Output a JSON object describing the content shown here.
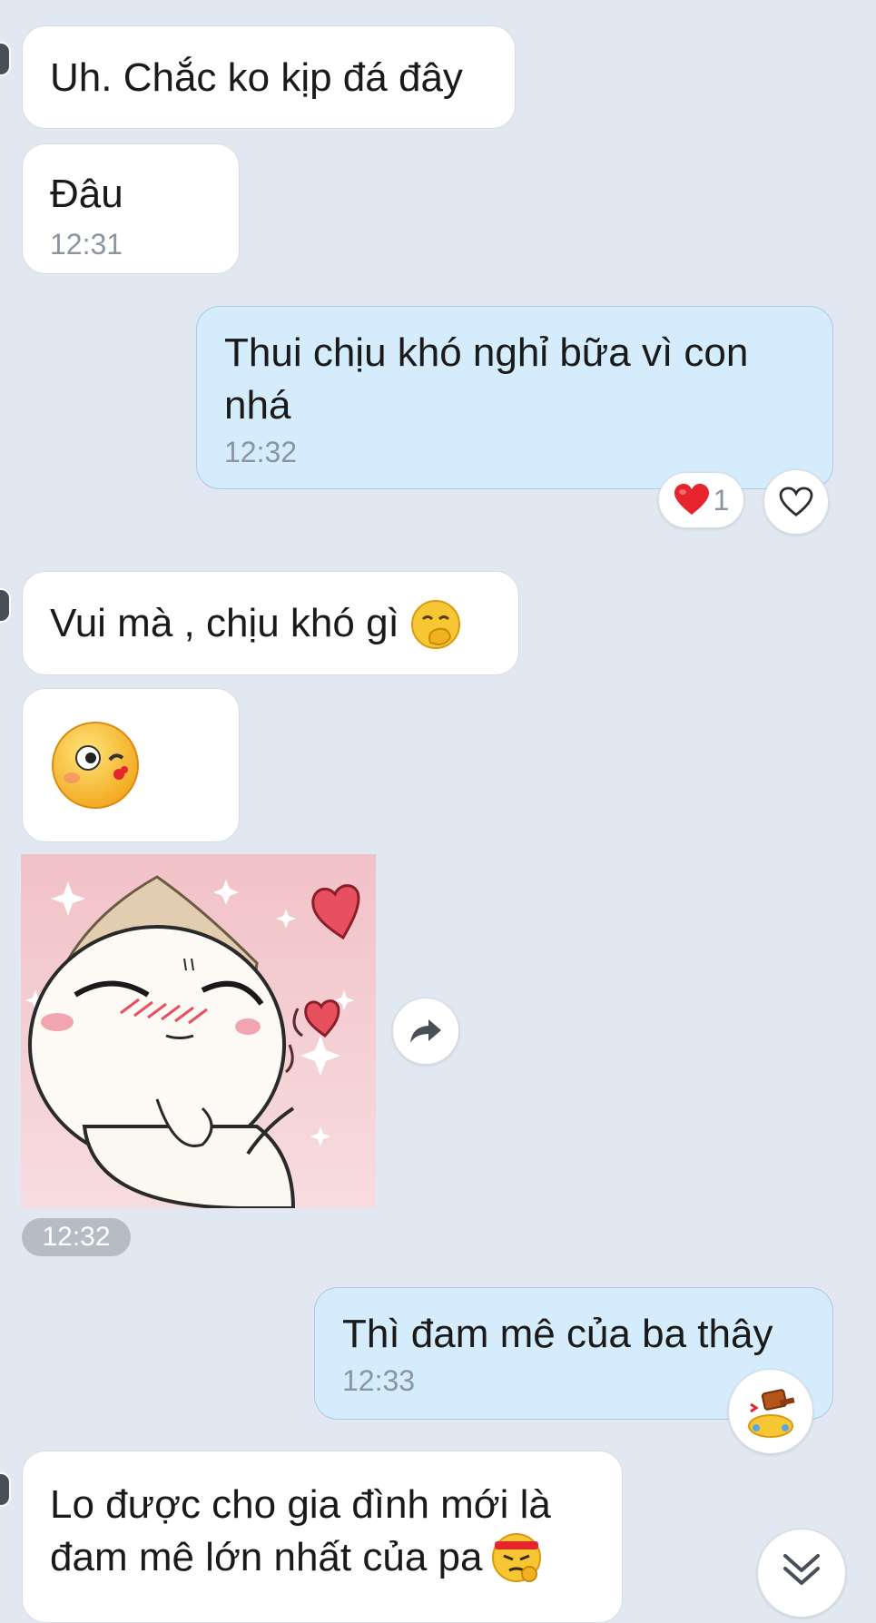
{
  "messages": {
    "m1_text": "Uh. Chắc ko kịp đá đây",
    "m2_text": "Đâu",
    "m2_time": "12:31",
    "m3_text_line1": "Thui  chịu khó nghỉ bữa vì con",
    "m3_text_line2": "nhá",
    "m3_time": "12:32",
    "m3_reaction_count": "1",
    "m4_text": "Vui mà , chịu khó gì",
    "m6_time": "12:32",
    "m7_text": "Thì đam mê của ba thây",
    "m7_time": "12:33",
    "m8_text_line1": "Lo được cho gia đình mới là",
    "m8_text_line2": "đam mê lớn nhất của pa"
  },
  "icons": {
    "reaction": "heart-icon",
    "like": "heart-outline-icon",
    "forward": "share-arrow-icon",
    "scroll": "double-chevron-down-icon"
  },
  "colors": {
    "background": "#e2e8f1",
    "incoming_bubble": "#ffffff",
    "outgoing_bubble": "#d4ecfb",
    "heart": "#e5242b"
  }
}
